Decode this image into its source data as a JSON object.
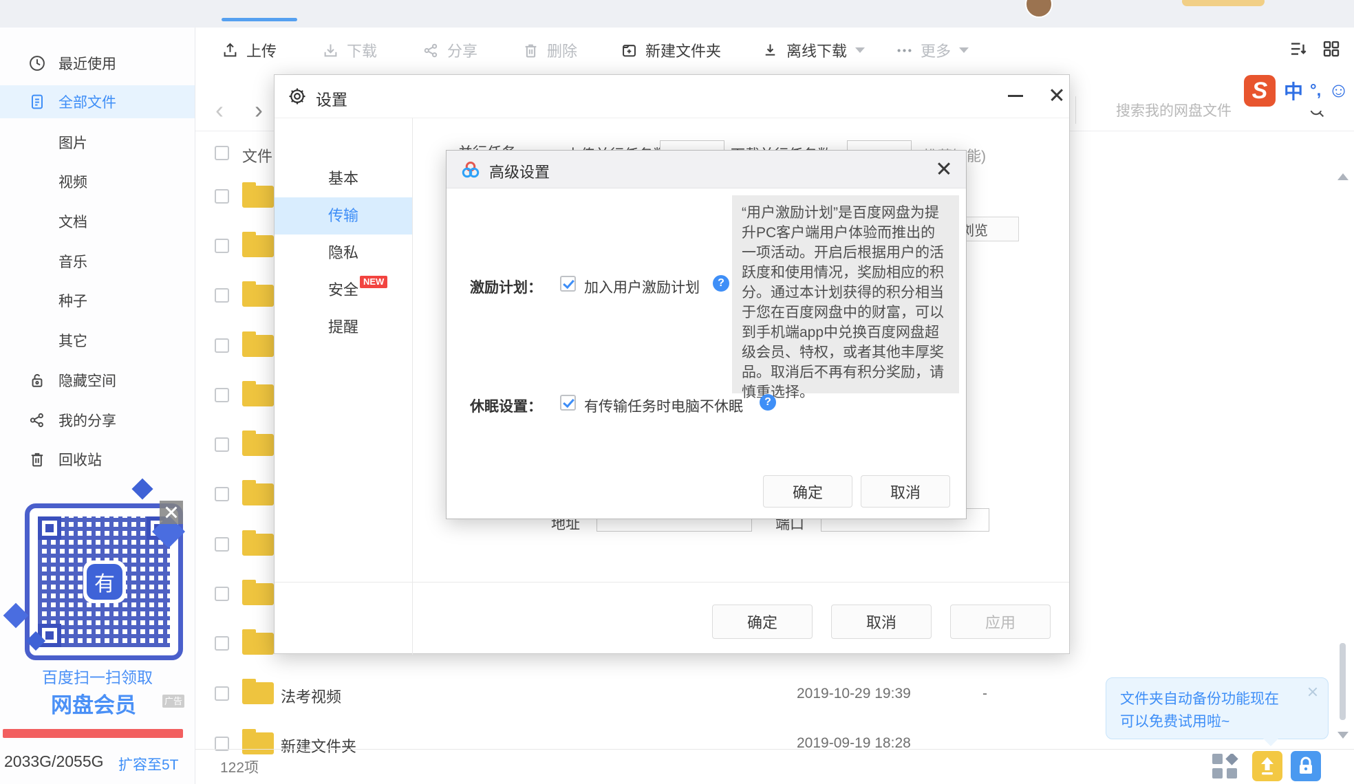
{
  "sidebar": {
    "items": [
      {
        "label": "最近使用",
        "icon": "clock-icon"
      },
      {
        "label": "全部文件",
        "icon": "file-list-icon",
        "selected": true
      },
      {
        "label": "图片"
      },
      {
        "label": "视频"
      },
      {
        "label": "文档"
      },
      {
        "label": "音乐"
      },
      {
        "label": "种子"
      },
      {
        "label": "其它"
      },
      {
        "label": "隐藏空间",
        "icon": "lock-icon"
      },
      {
        "label": "我的分享",
        "icon": "share-icon"
      },
      {
        "label": "回收站",
        "icon": "trash-icon"
      }
    ],
    "qr_ad": {
      "center_logo": "有",
      "line1": "百度扫一扫领取",
      "line2": "网盘会员",
      "badge": "广告"
    },
    "storage": {
      "usage": "2033G/2055G",
      "upgrade_link": "扩容至5T"
    }
  },
  "toolbar": {
    "upload": "上传",
    "download": "下载",
    "share": "分享",
    "delete": "删除",
    "new_folder": "新建文件夹",
    "offline_download": "离线下载",
    "more": "更多"
  },
  "search": {
    "placeholder": "搜索我的网盘文件"
  },
  "ime": {
    "logo": "S",
    "mode": "中",
    "punct": "°,",
    "emoji": "☺"
  },
  "file_list": {
    "header": "文件",
    "rows": [
      {
        "name": "法考视频",
        "time": "2019-10-29 19:39",
        "size": "-"
      },
      {
        "name": "新建文件夹",
        "time": "2019-09-19 18:28",
        "size": ""
      }
    ],
    "status": "122项"
  },
  "settings_dialog": {
    "title": "设置",
    "tabs": [
      {
        "label": "基本"
      },
      {
        "label": "传输",
        "selected": true
      },
      {
        "label": "隐私"
      },
      {
        "label": "安全",
        "badge": "NEW"
      },
      {
        "label": "提醒"
      }
    ],
    "fragments": {
      "parallel_label": "并行任务",
      "upload_parallel": "上传并行任务数",
      "download_parallel": "下载并行任务数",
      "recommend": "(推荐智能)",
      "browse": "浏览",
      "address": "地址",
      "port": "端口"
    },
    "buttons": {
      "ok": "确定",
      "cancel": "取消",
      "apply": "应用"
    }
  },
  "advanced_dialog": {
    "title": "高级设置",
    "incentive": {
      "label": "激励计划：",
      "checkbox_label": "加入用户激励计划",
      "checked": true,
      "tooltip": "“用户激励计划”是百度网盘为提升PC客户端用户体验而推出的一项活动。开启后根据用户的活跃度和使用情况，奖励相应的积分。通过本计划获得的积分相当于您在百度网盘中的财富，可以到手机端app中兑换百度网盘超级会员、特权，或者其他丰厚奖品。取消后不再有积分奖励，请慎重选择。"
    },
    "sleep": {
      "label": "休眠设置：",
      "checkbox_label": "有传输任务时电脑不休眠",
      "checked": true
    },
    "buttons": {
      "ok": "确定",
      "cancel": "取消"
    }
  },
  "toast": {
    "line1": "文件夹自动备份功能现在",
    "line2": "可以免费试用啦~"
  },
  "colors": {
    "accent_blue": "#3e8ef7",
    "selected_bg": "#e7f3fe",
    "new_badge_red": "#f24440",
    "folder_yellow": "#eec43f",
    "quota_red": "#f25f5f",
    "qr_blue": "#3b50bd",
    "toast_bg": "#eaf5fe",
    "sogou_orange": "#e8552e"
  }
}
